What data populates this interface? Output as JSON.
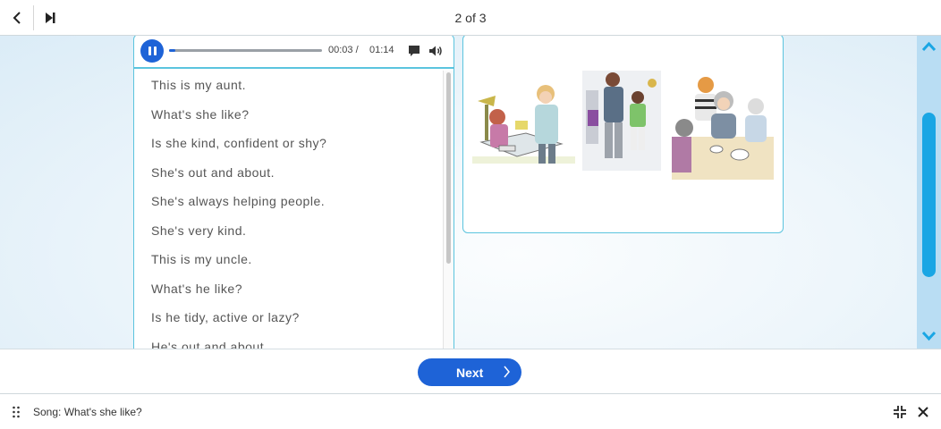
{
  "header": {
    "page_indicator": "2 of 3"
  },
  "player": {
    "current_time": "00:03 /",
    "total_time": "01:14",
    "progress_fraction": 0.04
  },
  "lyrics": [
    "This is my aunt.",
    "What's she like?",
    "Is she kind, confident or shy?",
    "She's out and about.",
    "She's always helping people.",
    "She's very kind.",
    "This is my uncle.",
    "What's he like?",
    "Is he tidy, active or lazy?",
    "He's out and about."
  ],
  "footer": {
    "next_label": "Next"
  },
  "statusbar": {
    "title": "Song: What's she like?"
  },
  "colors": {
    "accent": "#1e63d7",
    "panel_border": "#5bc4de",
    "scroll_thumb": "#1aa6e4"
  },
  "icons": [
    "chevron-left-icon",
    "skip-forward-icon",
    "pause-icon",
    "captions-icon",
    "volume-icon",
    "chevron-up-icon",
    "chevron-down-icon",
    "chevron-right-icon",
    "drag-handle-icon",
    "collapse-icon",
    "close-icon"
  ]
}
